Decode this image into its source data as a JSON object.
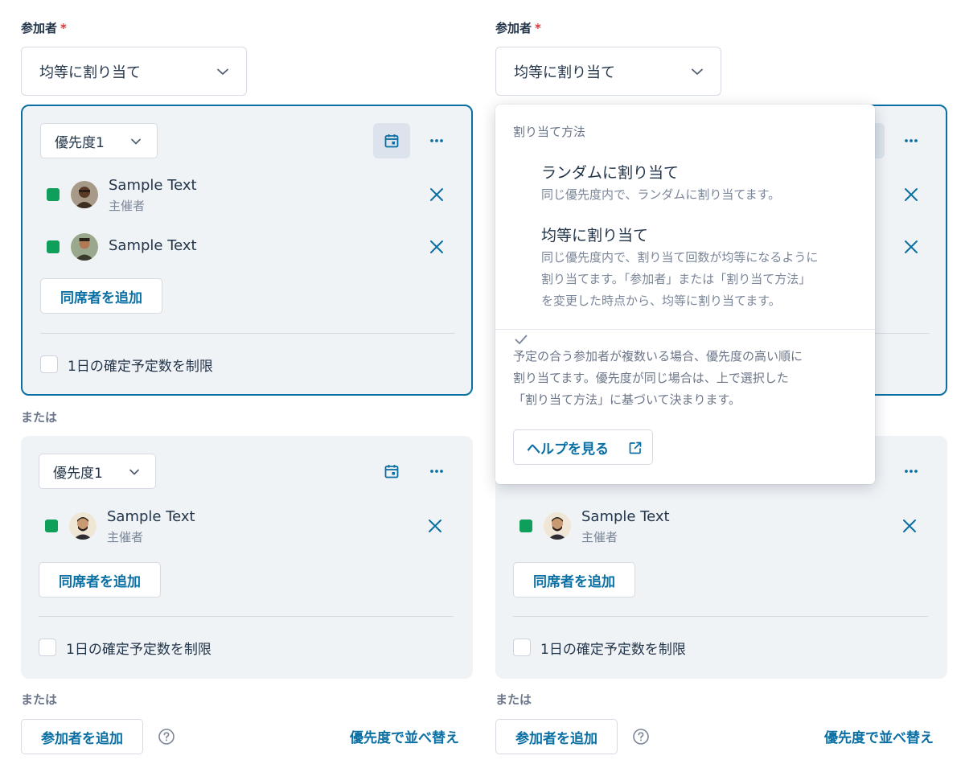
{
  "colors": {
    "accent": "#0a6fa3",
    "status_green": "#0e9f5b",
    "required": "#d8383b",
    "panel_bg": "#f0f3f6"
  },
  "icons": {
    "chevron": "chevron-down-icon",
    "calendar": "calendar-icon",
    "more": "more-horizontal-icon",
    "remove": "close-icon",
    "help": "help-circle-icon",
    "check": "check-icon",
    "external": "external-link-icon"
  },
  "left": {
    "attendees_label": "参加者",
    "required_mark": "*",
    "method_value": "均等に割り当て",
    "group1": {
      "priority": "優先度1",
      "members": [
        {
          "name": "Sample Text",
          "role": "主催者"
        },
        {
          "name": "Sample Text"
        }
      ],
      "add_companion": "同席者を追加",
      "limit_label": "1日の確定予定数を制限"
    },
    "or1": "または",
    "group2": {
      "priority": "優先度1",
      "members": [
        {
          "name": "Sample Text",
          "role": "主催者"
        }
      ],
      "add_companion": "同席者を追加",
      "limit_label": "1日の確定予定数を制限"
    },
    "or2": "または",
    "add_attendee": "参加者を追加",
    "sort_by_priority": "優先度で並べ替え"
  },
  "right": {
    "attendees_label": "参加者",
    "required_mark": "*",
    "method_value": "均等に割り当て",
    "group2": {
      "members": [
        {
          "name": "Sample Text",
          "role": "主催者"
        }
      ],
      "add_companion": "同席者を追加",
      "limit_label": "1日の確定予定数を制限"
    },
    "or2": "または",
    "add_attendee": "参加者を追加",
    "sort_by_priority": "優先度で並べ替え"
  },
  "dropdown": {
    "heading": "割り当て方法",
    "options": [
      {
        "title": "ランダムに割り当て",
        "desc": [
          "同じ優先度内で、ランダムに割り当てます。"
        ],
        "selected": false
      },
      {
        "title": "均等に割り当て",
        "desc": [
          "同じ優先度内で、割り当て回数が均等になるように",
          "割り当てます。「参加者」または「割り当て方法」",
          "を変更した時点から、均等に割り当てます。"
        ],
        "selected": true
      }
    ],
    "note": [
      "予定の合う参加者が複数いる場合、優先度の高い順に",
      "割り当てます。優先度が同じ場合は、上で選択した",
      "「割り当て方法」に基づいて決まります。"
    ],
    "help_button": "ヘルプを見る"
  }
}
